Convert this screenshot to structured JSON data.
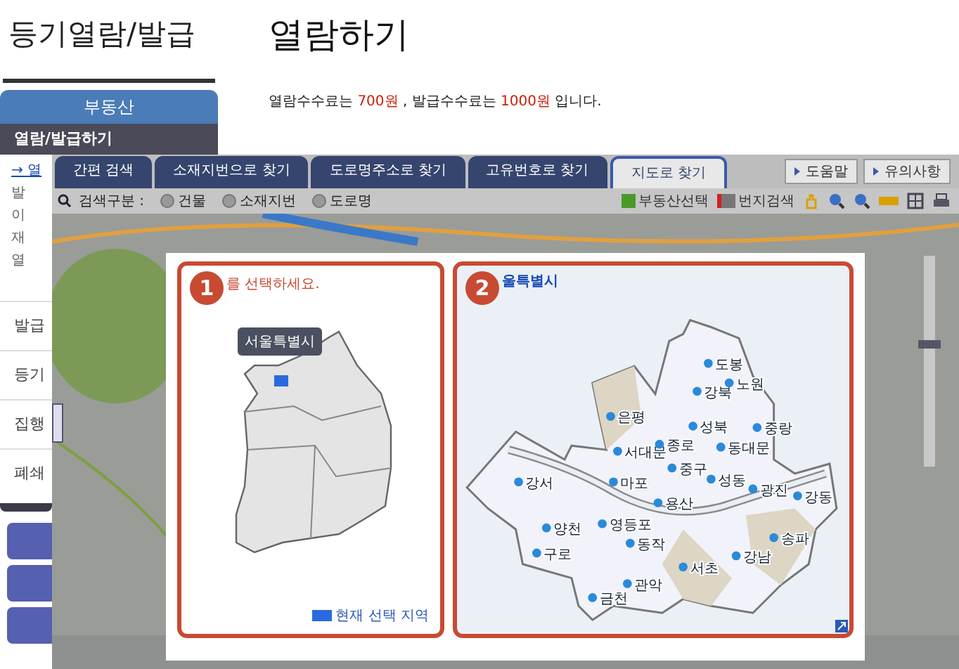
{
  "sidebar": {
    "title": "등기열람/발급",
    "header": "부동산",
    "active_item": "열람/발급하기",
    "sub_items": [
      {
        "label": "→ 열",
        "selected": true
      },
      {
        "label": "발",
        "selected": false
      },
      {
        "label": "이",
        "selected": false
      },
      {
        "label": "재",
        "selected": false
      },
      {
        "label": "열",
        "selected": false
      }
    ],
    "sections": [
      "발급",
      "등기",
      "집행",
      "폐쇄"
    ]
  },
  "page": {
    "title": "열람하기",
    "notice": [
      {
        "text": "열람수수료는 ",
        "highlight": false
      },
      {
        "text": "700원",
        "highlight": true
      },
      {
        "text": " , 발급수수료는 ",
        "highlight": false
      },
      {
        "text": "1000원",
        "highlight": true
      },
      {
        "text": " 입니다.",
        "highlight": false
      }
    ]
  },
  "search_window": {
    "tabs": [
      {
        "label": "간편 검색",
        "selected": false
      },
      {
        "label": "소재지번으로 찾기",
        "selected": false
      },
      {
        "label": "도로명주소로 찾기",
        "selected": false
      },
      {
        "label": "고유번호로 찾기",
        "selected": false
      },
      {
        "label": "지도로 찾기",
        "selected": true
      }
    ],
    "links": [
      "도움말",
      "유의사항"
    ],
    "search_label": "검색구분 :",
    "radios": [
      {
        "label": "건물",
        "selected": false
      },
      {
        "label": "소재지번",
        "selected": false
      },
      {
        "label": "도로명",
        "selected": false
      }
    ],
    "tools": [
      "부동산선택",
      "번지검색"
    ],
    "region_panel": {
      "badge": "1",
      "prompt": "를 선택하세요.",
      "tooltip": "서울특별시",
      "legend": "현재 선택 지역"
    },
    "district_panel": {
      "badge": "2",
      "title": "울특별시",
      "districts": [
        "도봉",
        "강북",
        "노원",
        "은평",
        "성북",
        "중랑",
        "서대문",
        "종로",
        "동대문",
        "중구",
        "마포",
        "성동",
        "광진",
        "강동",
        "강서",
        "용산",
        "양천",
        "영등포",
        "동작",
        "송파",
        "구로",
        "강남",
        "서초",
        "관악",
        "금천"
      ]
    }
  }
}
